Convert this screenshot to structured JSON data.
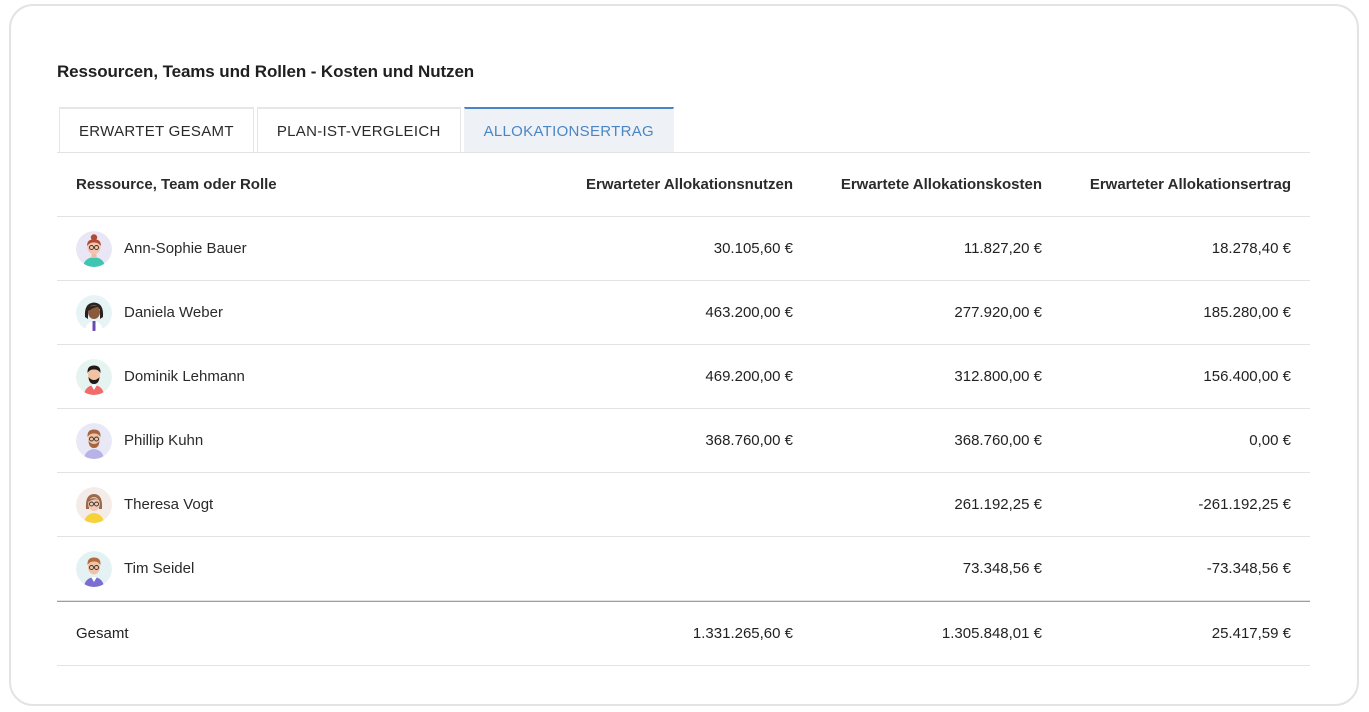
{
  "section": {
    "title": "Ressourcen, Teams und Rollen - Kosten und Nutzen"
  },
  "tabs": [
    {
      "label": "ERWARTET GESAMT",
      "active": false
    },
    {
      "label": "PLAN-IST-VERGLEICH",
      "active": false
    },
    {
      "label": "ALLOKATIONSERTRAG",
      "active": true
    }
  ],
  "table": {
    "headers": {
      "name": "Ressource, Team oder Rolle",
      "benefit": "Erwarteter Allokationsnutzen",
      "cost": "Erwartete Allokationskosten",
      "yield": "Erwarteter Allokationsertrag"
    },
    "rows": [
      {
        "name": "Ann-Sophie Bauer",
        "avatar": "avatar-woman-bun-icon",
        "benefit": "30.105,60 €",
        "cost": "11.827,20 €",
        "yield": "18.278,40 €"
      },
      {
        "name": "Daniela Weber",
        "avatar": "avatar-woman-dark-hair-icon",
        "benefit": "463.200,00 €",
        "cost": "277.920,00 €",
        "yield": "185.280,00 €"
      },
      {
        "name": "Dominik Lehmann",
        "avatar": "avatar-man-beard-icon",
        "benefit": "469.200,00 €",
        "cost": "312.800,00 €",
        "yield": "156.400,00 €"
      },
      {
        "name": "Phillip Kuhn",
        "avatar": "avatar-man-glasses-beard-icon",
        "benefit": "368.760,00 €",
        "cost": "368.760,00 €",
        "yield": "0,00 €"
      },
      {
        "name": "Theresa Vogt",
        "avatar": "avatar-woman-glasses-icon",
        "benefit": "",
        "cost": "261.192,25 €",
        "yield": "-261.192,25 €"
      },
      {
        "name": "Tim Seidel",
        "avatar": "avatar-man-glasses-icon",
        "benefit": "",
        "cost": "73.348,56 €",
        "yield": "-73.348,56 €"
      }
    ],
    "total": {
      "label": "Gesamt",
      "benefit": "1.331.265,60 €",
      "cost": "1.305.848,01 €",
      "yield": "25.417,59 €"
    }
  },
  "colors": {
    "accent": "#4a86c5",
    "active_tab_bg": "#eef1f6",
    "border": "#e3e3e3"
  }
}
